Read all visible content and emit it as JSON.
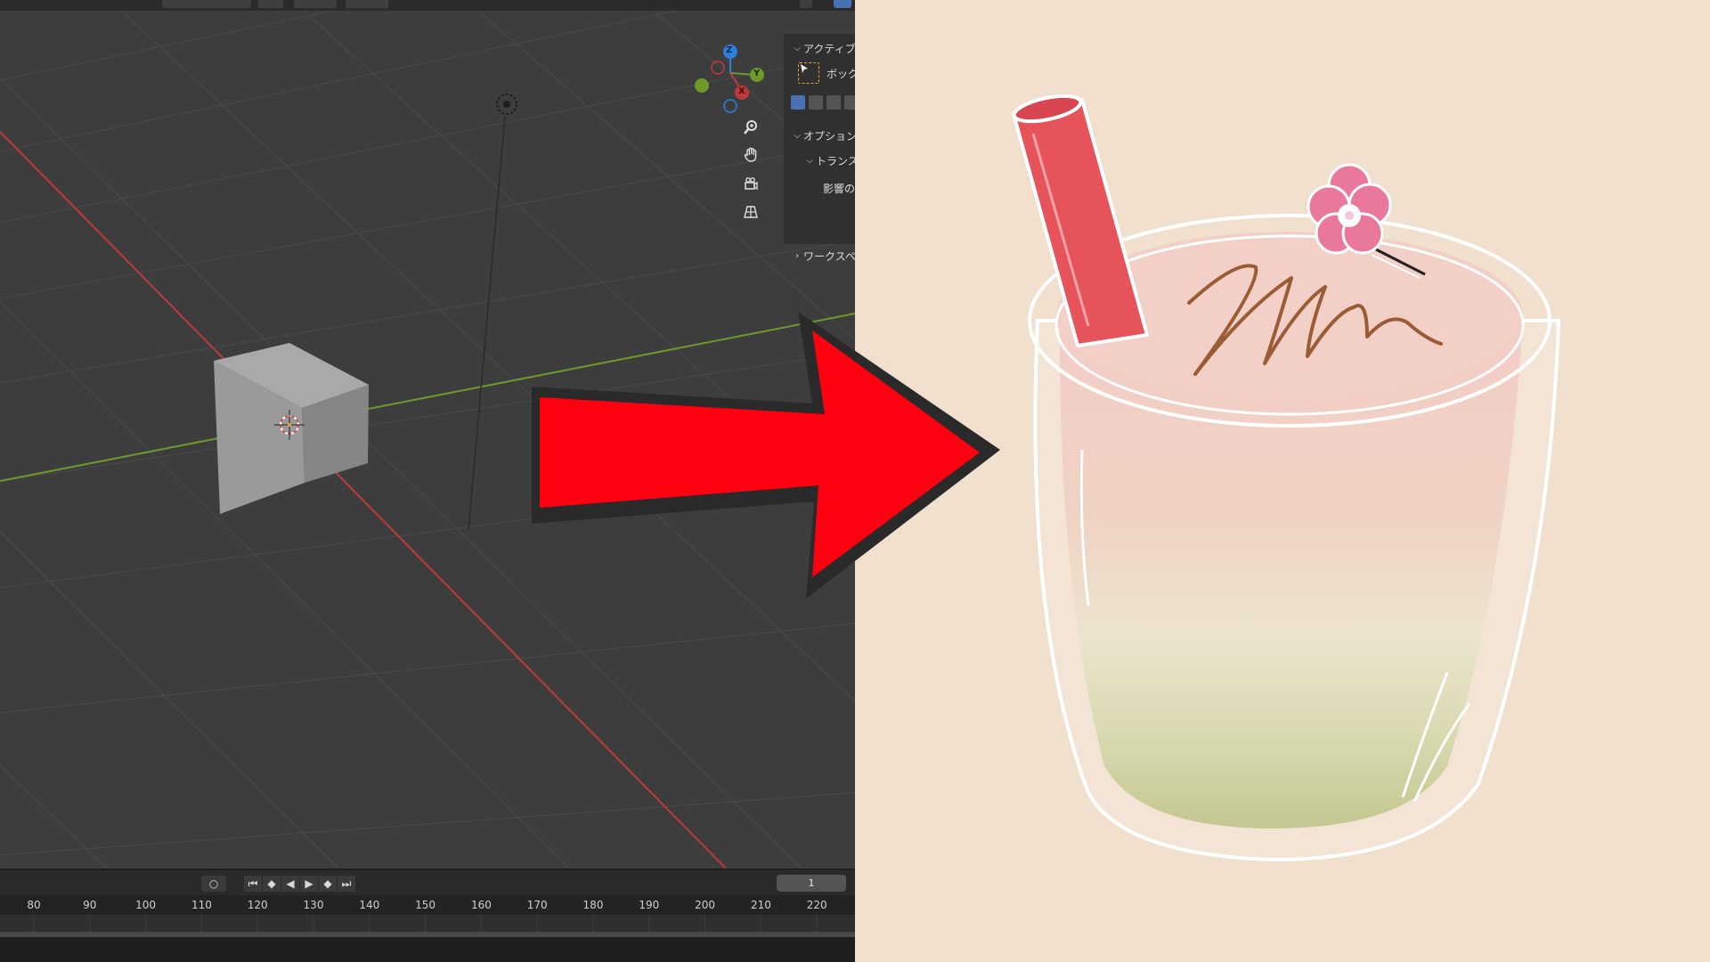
{
  "panel": {
    "active_tool_header": "アクティブ",
    "active_tool_name": "ボックス",
    "options_header": "オプション",
    "transform_header": "トランス",
    "affect_label": "影響の",
    "workspace_header": "ワークスペ"
  },
  "gizmo": {
    "x_label": "X",
    "y_label": "Y",
    "z_label": "Z"
  },
  "timeline": {
    "current_frame": "1",
    "ticks": [
      "80",
      "90",
      "100",
      "110",
      "120",
      "130",
      "140",
      "150",
      "160",
      "170",
      "180",
      "190",
      "200",
      "210",
      "220"
    ]
  },
  "icons": {
    "zoom": "zoom-icon",
    "pan": "hand-icon",
    "camera": "camera-icon",
    "grid": "grid-icon",
    "light": "light-icon",
    "cursor": "3d-cursor-icon",
    "select_box": "select-box-icon"
  },
  "colors": {
    "viewport_bg": "#3d3d3d",
    "x_axis": "#c0393b",
    "y_axis": "#6d9a2a",
    "z_axis": "#2e7fd9",
    "arrow_fill": "#ff0010",
    "arrow_shadow": "#2a2a2a",
    "illustration_bg": "#f2e0ce",
    "straw": "#e6535b",
    "flower": "#e9789a"
  }
}
